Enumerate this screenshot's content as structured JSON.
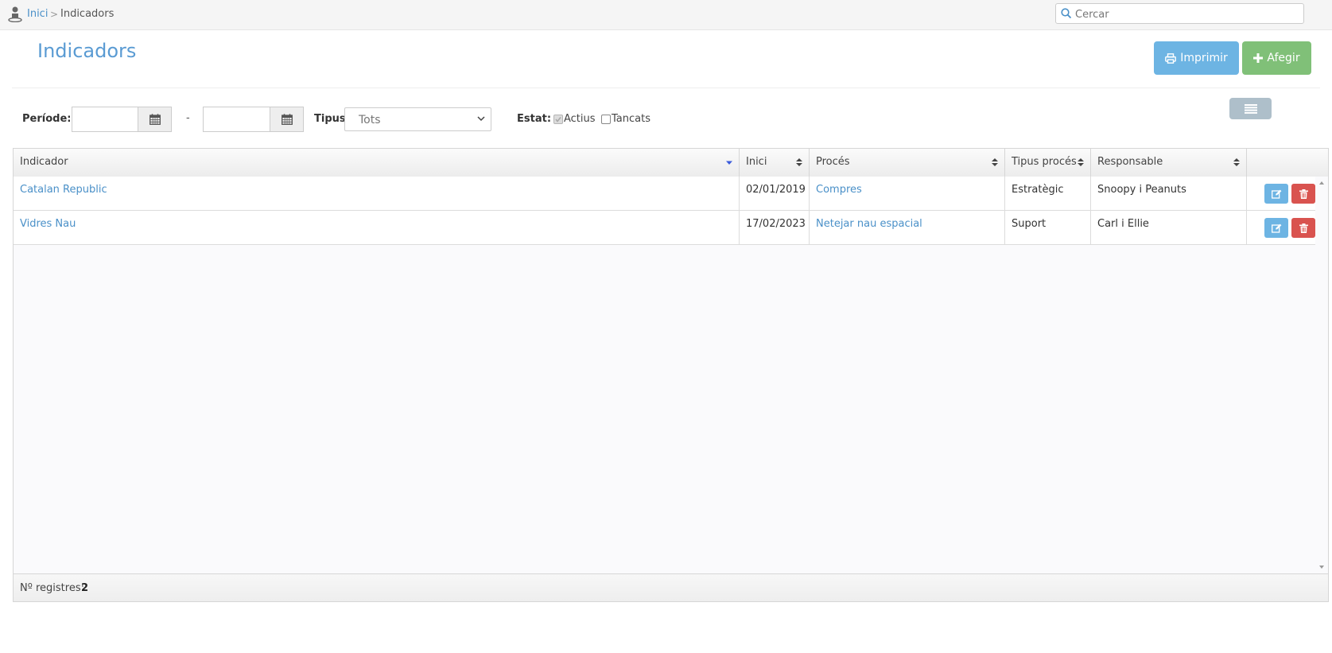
{
  "breadcrumb": {
    "home": "Inici",
    "separator": ">",
    "current": "Indicadors"
  },
  "search": {
    "placeholder": "Cercar"
  },
  "header": {
    "title": "Indicadors",
    "print_label": "Imprimir",
    "add_label": "Afegir"
  },
  "filters": {
    "period_label": "Període:",
    "period_separator": "-",
    "period_from": "",
    "period_to": "",
    "type_label": "Tipus:",
    "type_value": "Tots",
    "status_label": "Estat:",
    "status_active_label": "Actius",
    "status_active_checked": true,
    "status_closed_label": "Tancats",
    "status_closed_checked": false
  },
  "table": {
    "columns": [
      "Indicador",
      "Inici",
      "Procés",
      "Tipus procés",
      "Responsable"
    ],
    "rows": [
      {
        "indicador": "Catalan Republic",
        "inici": "02/01/2019",
        "proces": "Compres",
        "tipus": "Estratègic",
        "responsable": "Snoopy i Peanuts"
      },
      {
        "indicador": "Vidres Nau",
        "inici": "17/02/2023",
        "proces": "Netejar nau espacial",
        "tipus": "Suport",
        "responsable": "Carl i Ellie"
      }
    ],
    "footer_label": "Nº registres:",
    "record_count": "2"
  },
  "colors": {
    "accent": "#5a9bd3",
    "print": "#6db4e3",
    "add": "#80c078",
    "delete": "#d9534f",
    "list_button": "#aebfca"
  },
  "icons": [
    "user-icon",
    "search-icon",
    "print-icon",
    "plus-icon",
    "list-icon",
    "calendar-icon",
    "chevron-down-icon",
    "sort-icon",
    "edit-icon",
    "trash-icon"
  ]
}
